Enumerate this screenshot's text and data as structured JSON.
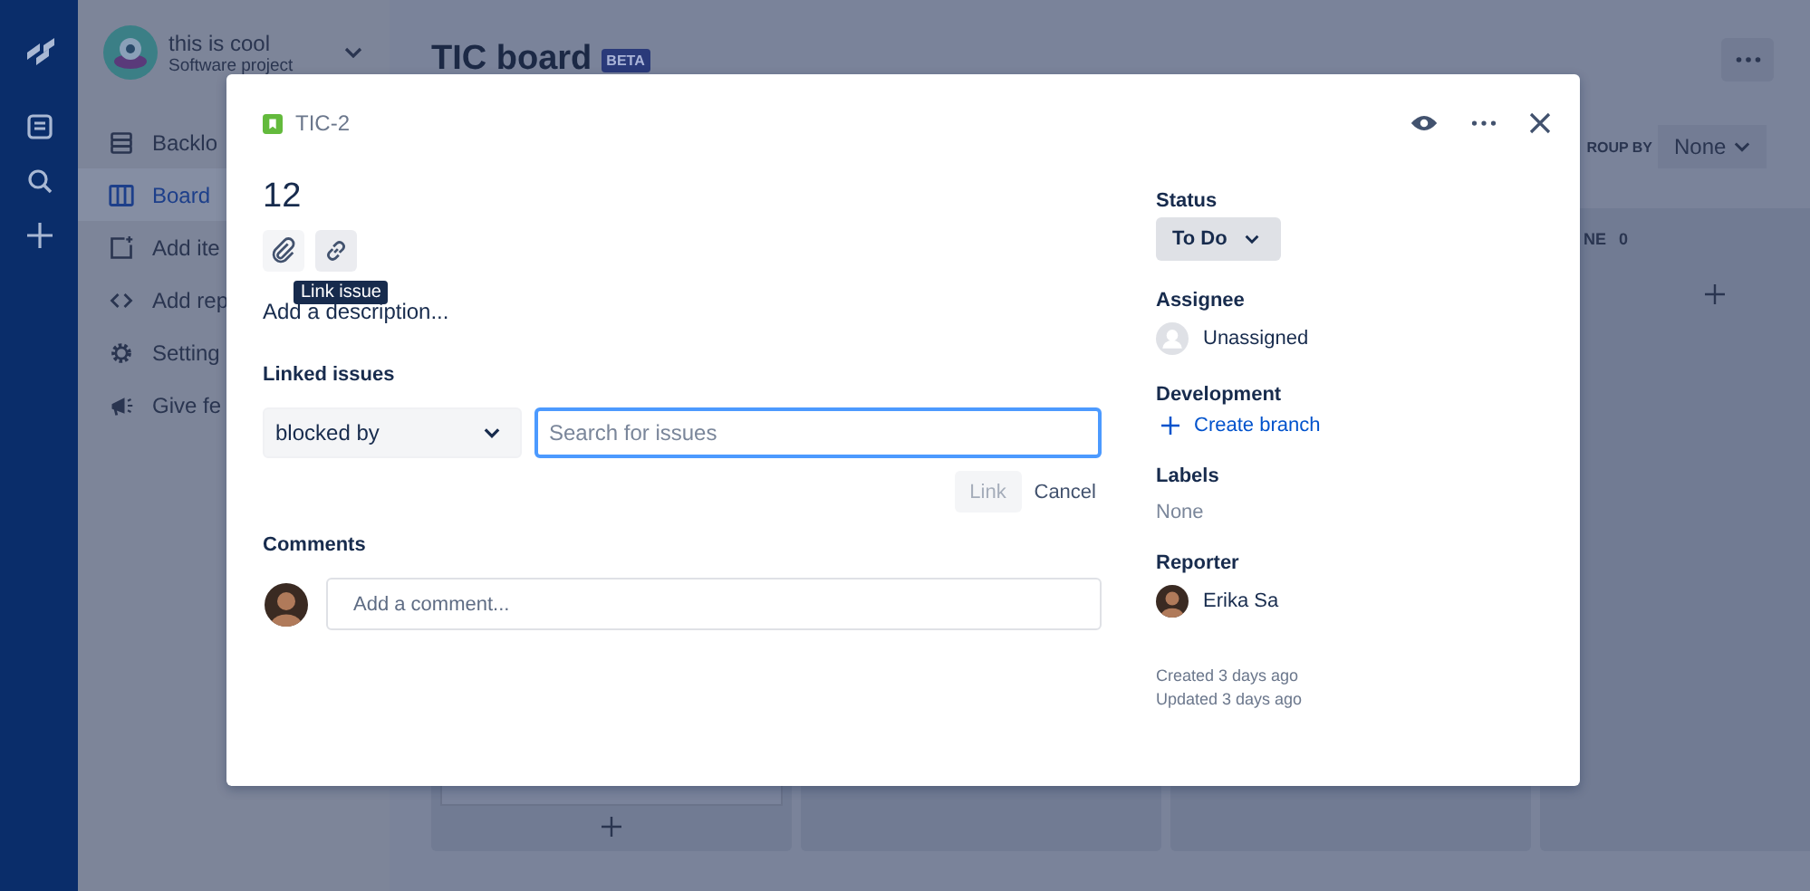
{
  "project": {
    "name": "this is cool",
    "type": "Software project"
  },
  "sidebar": {
    "items": [
      {
        "label": "Backlo",
        "selected": false
      },
      {
        "label": "Board",
        "selected": true
      },
      {
        "label": "Add ite",
        "selected": false
      },
      {
        "label": "Add rep",
        "selected": false
      },
      {
        "label": "Setting",
        "selected": false
      },
      {
        "label": "Give fe",
        "selected": false
      }
    ]
  },
  "board": {
    "title": "TIC board",
    "badge": "BETA",
    "group_by_label": "ROUP BY",
    "group_by_value": "None",
    "column_header": "NE",
    "column_count": "0"
  },
  "issue_dialog": {
    "key": "TIC-2",
    "title": "12",
    "tooltip": "Link issue",
    "description_placeholder": "Add a description...",
    "linked_issues": {
      "heading": "Linked issues",
      "relation": "blocked by",
      "search_placeholder": "Search for issues",
      "link_button": {
        "label": "Link",
        "disabled": true
      },
      "cancel_button": "Cancel"
    },
    "comments": {
      "heading": "Comments",
      "placeholder": "Add a comment..."
    },
    "status": {
      "heading": "Status",
      "value": "To Do"
    },
    "assignee": {
      "heading": "Assignee",
      "value": "Unassigned"
    },
    "development": {
      "heading": "Development",
      "action": "Create branch"
    },
    "labels": {
      "heading": "Labels",
      "value": "None"
    },
    "reporter": {
      "heading": "Reporter",
      "value": "Erika Sa"
    },
    "created": "Created 3 days ago",
    "updated": "Updated 3 days ago"
  }
}
